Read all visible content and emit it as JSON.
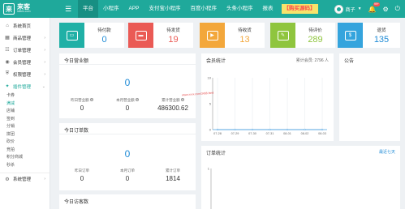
{
  "brand": {
    "logo_char": "来",
    "name": "来客",
    "sub": "laikes.com"
  },
  "nav": [
    "平台",
    "小程序",
    "APP",
    "支付宝小程序",
    "百度小程序",
    "头条小程序",
    "报表"
  ],
  "buy_label": "【购买源码】",
  "user": {
    "name": "商子",
    "notifications": "99+"
  },
  "sidebar": {
    "home": "系统首页",
    "items": [
      "商品管理",
      "订单管理",
      "会员管理",
      "权限管理"
    ],
    "plugin": "插件管理",
    "sub_items": [
      "卡券",
      "满减",
      "店铺",
      "签到",
      "分销",
      "拼团",
      "砍价",
      "竞拍",
      "积分商城",
      "秒杀"
    ],
    "system": "系统管理"
  },
  "stats": [
    {
      "label": "待付款",
      "value": "0",
      "color": "#20b0a6",
      "value_color": "#1f8bd6",
      "icon": "wallet-icon"
    },
    {
      "label": "待发货",
      "value": "19",
      "color": "#ea5a55",
      "value_color": "#ea5a55",
      "icon": "box-icon"
    },
    {
      "label": "待收货",
      "value": "13",
      "color": "#f3a73b",
      "value_color": "#f3a73b",
      "icon": "truck-icon"
    },
    {
      "label": "待评价",
      "value": "289",
      "color": "#8fc53e",
      "value_color": "#8fc53e",
      "icon": "edit-icon"
    },
    {
      "label": "退货",
      "value": "135",
      "color": "#35a4dd",
      "value_color": "#1f8bd6",
      "icon": "refund-icon"
    }
  ],
  "revenue": {
    "title": "今日营业额",
    "value": "0",
    "subs": [
      {
        "label": "昨日营业额",
        "value": "0"
      },
      {
        "label": "本月营业额",
        "value": "0"
      },
      {
        "label": "累计营业额",
        "value": "486300.62"
      }
    ]
  },
  "orders": {
    "title": "今日订单数",
    "value": "0",
    "subs": [
      {
        "label": "昨日订单",
        "value": "0"
      },
      {
        "label": "本月订单",
        "value": "0"
      },
      {
        "label": "累计订单",
        "value": "1814"
      }
    ]
  },
  "visits": {
    "title": "今日访客数"
  },
  "members": {
    "title": "会员统计",
    "total_label": "累计会员: 2796 人"
  },
  "notice": {
    "title": "公告"
  },
  "order_stats": {
    "title": "订单统计",
    "filter": "最近七天"
  },
  "watermark": "www.xxxx.com/3456.html",
  "chart_data": [
    {
      "type": "line",
      "categories": [
        "07-28",
        "07-29",
        "07-30",
        "07-31",
        "08-01",
        "08-02",
        "08-03"
      ],
      "series": [
        {
          "values": [
            0,
            0,
            0,
            0,
            0,
            0,
            0
          ]
        }
      ],
      "ylim": [
        0,
        10
      ],
      "yticks": [
        "10",
        "5",
        "0"
      ],
      "grid": true,
      "color": "#4aa0e0"
    },
    {
      "type": "line",
      "categories": [],
      "series": [],
      "ylim": [
        0,
        1
      ],
      "yticks": [
        "1"
      ],
      "grid": false
    }
  ]
}
